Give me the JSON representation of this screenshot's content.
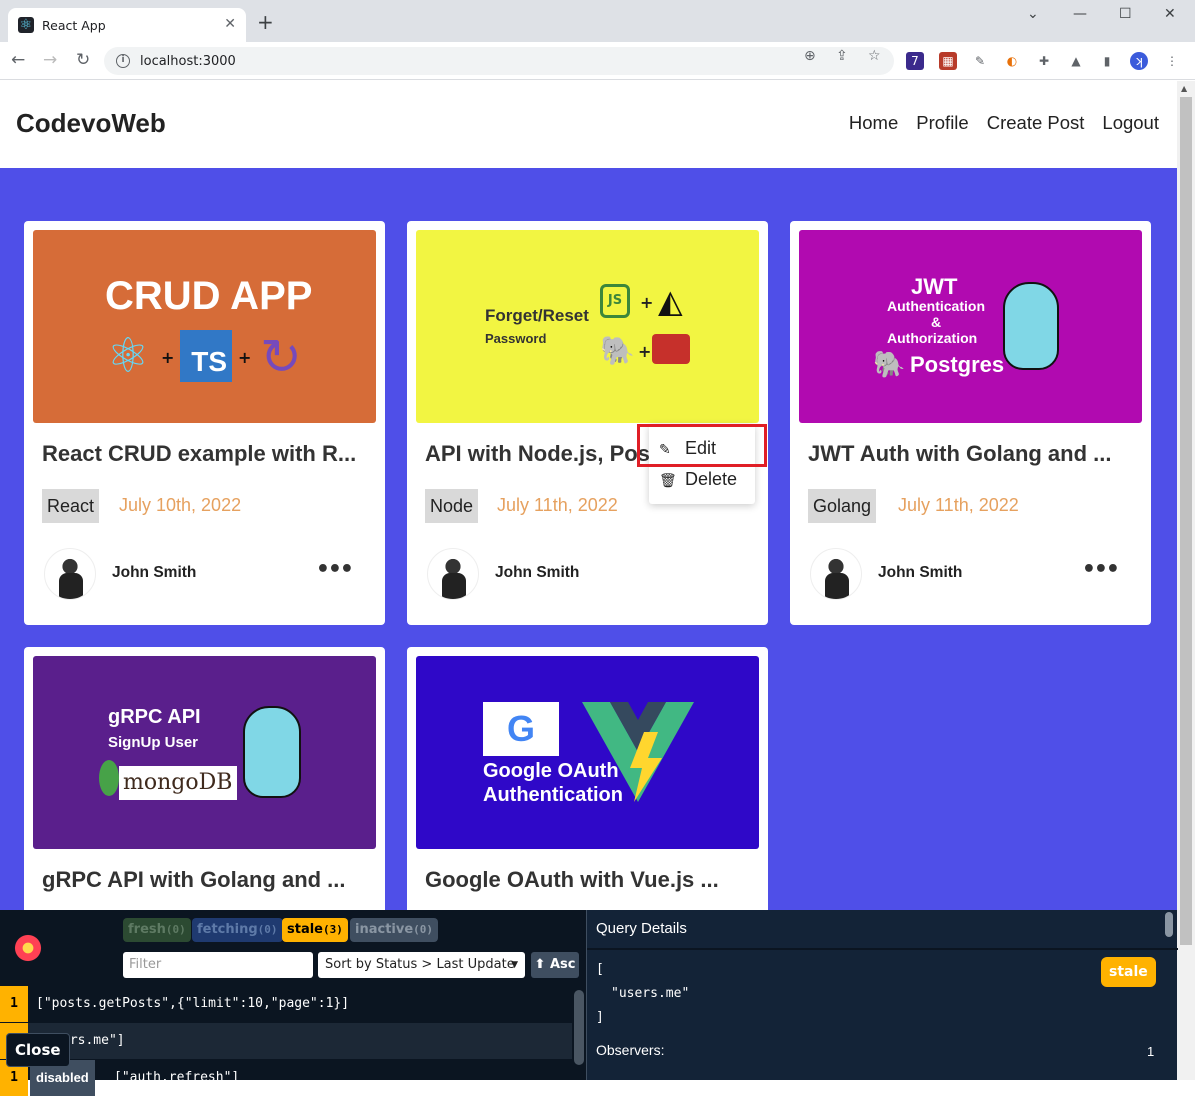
{
  "browser": {
    "tab_title": "React App",
    "url": "localhost:3000",
    "ext_badge": "7"
  },
  "app": {
    "brand": "CodevoWeb",
    "nav": [
      "Home",
      "Profile",
      "Create Post",
      "Logout"
    ]
  },
  "posts": [
    {
      "title": "React CRUD example with R...",
      "tag": "React",
      "date": "July 10th, 2022",
      "author": "John Smith",
      "thumb": {
        "bg": "#d66c38",
        "line1": "CRUD APP",
        "line2": "TS"
      }
    },
    {
      "title": "API with Node.js, Postgre...",
      "tag": "Node",
      "date": "July 11th, 2022",
      "author": "John Smith",
      "thumb": {
        "bg": "#f2f542",
        "line1": "Forget/Reset",
        "line2": "Password"
      }
    },
    {
      "title": "JWT Auth with Golang and ...",
      "tag": "Golang",
      "date": "July 11th, 2022",
      "author": "John Smith",
      "thumb": {
        "bg": "#b10ab0",
        "line1": "JWT",
        "line2": "Authentication",
        "line3": "&",
        "line4": "Authorization",
        "line5": "Postgres"
      }
    },
    {
      "title": "gRPC API with Golang and ...",
      "thumb": {
        "bg": "#5a1f8c",
        "line1": "gRPC API",
        "line2": "SignUp User",
        "line3": "mongoDB"
      }
    },
    {
      "title": "Google OAuth with Vue.js ...",
      "thumb": {
        "bg": "#2f08c8",
        "line1": "Google OAuth",
        "line2": "Authentication"
      }
    }
  ],
  "context_menu": {
    "edit": "Edit",
    "delete": "Delete"
  },
  "devtools": {
    "badges": {
      "fresh": "fresh",
      "fresh_count": "(0)",
      "fetching": "fetching",
      "fetching_count": "(0)",
      "stale": "stale",
      "stale_count": "(3)",
      "inactive": "inactive",
      "inactive_count": "(0)"
    },
    "filter_placeholder": "Filter",
    "sort_label": "Sort by Status > Last Update",
    "asc_label": "⬆ Asc",
    "queries": [
      {
        "count": "1",
        "key": "[\"posts.getPosts\",{\"limit\":10,\"page\":1}]"
      },
      {
        "count": "1",
        "key": "[\"users.me\"]",
        "visible_key": "ers.me\"]"
      },
      {
        "count": "1",
        "label": "disabled",
        "key": "[\"auth.refresh\"]"
      }
    ],
    "close_label": "Close",
    "details_title": "Query Details",
    "details_key_open": "[",
    "details_key": "\"users.me\"",
    "details_key_close": "]",
    "details_status": "stale",
    "observers_label": "Observers:",
    "observers_value": "1"
  },
  "colors": {
    "page_bg": "#4f4fe8",
    "date": "#e6a15f",
    "highlight": "#e01e26",
    "stale": "#ffb200"
  }
}
